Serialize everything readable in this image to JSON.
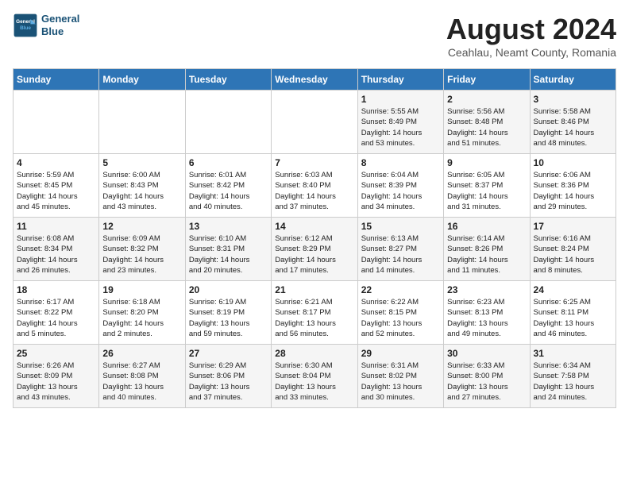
{
  "header": {
    "logo_line1": "General",
    "logo_line2": "Blue",
    "title": "August 2024",
    "subtitle": "Ceahlau, Neamt County, Romania"
  },
  "weekdays": [
    "Sunday",
    "Monday",
    "Tuesday",
    "Wednesday",
    "Thursday",
    "Friday",
    "Saturday"
  ],
  "weeks": [
    [
      {
        "day": "",
        "info": ""
      },
      {
        "day": "",
        "info": ""
      },
      {
        "day": "",
        "info": ""
      },
      {
        "day": "",
        "info": ""
      },
      {
        "day": "1",
        "info": "Sunrise: 5:55 AM\nSunset: 8:49 PM\nDaylight: 14 hours\nand 53 minutes."
      },
      {
        "day": "2",
        "info": "Sunrise: 5:56 AM\nSunset: 8:48 PM\nDaylight: 14 hours\nand 51 minutes."
      },
      {
        "day": "3",
        "info": "Sunrise: 5:58 AM\nSunset: 8:46 PM\nDaylight: 14 hours\nand 48 minutes."
      }
    ],
    [
      {
        "day": "4",
        "info": "Sunrise: 5:59 AM\nSunset: 8:45 PM\nDaylight: 14 hours\nand 45 minutes."
      },
      {
        "day": "5",
        "info": "Sunrise: 6:00 AM\nSunset: 8:43 PM\nDaylight: 14 hours\nand 43 minutes."
      },
      {
        "day": "6",
        "info": "Sunrise: 6:01 AM\nSunset: 8:42 PM\nDaylight: 14 hours\nand 40 minutes."
      },
      {
        "day": "7",
        "info": "Sunrise: 6:03 AM\nSunset: 8:40 PM\nDaylight: 14 hours\nand 37 minutes."
      },
      {
        "day": "8",
        "info": "Sunrise: 6:04 AM\nSunset: 8:39 PM\nDaylight: 14 hours\nand 34 minutes."
      },
      {
        "day": "9",
        "info": "Sunrise: 6:05 AM\nSunset: 8:37 PM\nDaylight: 14 hours\nand 31 minutes."
      },
      {
        "day": "10",
        "info": "Sunrise: 6:06 AM\nSunset: 8:36 PM\nDaylight: 14 hours\nand 29 minutes."
      }
    ],
    [
      {
        "day": "11",
        "info": "Sunrise: 6:08 AM\nSunset: 8:34 PM\nDaylight: 14 hours\nand 26 minutes."
      },
      {
        "day": "12",
        "info": "Sunrise: 6:09 AM\nSunset: 8:32 PM\nDaylight: 14 hours\nand 23 minutes."
      },
      {
        "day": "13",
        "info": "Sunrise: 6:10 AM\nSunset: 8:31 PM\nDaylight: 14 hours\nand 20 minutes."
      },
      {
        "day": "14",
        "info": "Sunrise: 6:12 AM\nSunset: 8:29 PM\nDaylight: 14 hours\nand 17 minutes."
      },
      {
        "day": "15",
        "info": "Sunrise: 6:13 AM\nSunset: 8:27 PM\nDaylight: 14 hours\nand 14 minutes."
      },
      {
        "day": "16",
        "info": "Sunrise: 6:14 AM\nSunset: 8:26 PM\nDaylight: 14 hours\nand 11 minutes."
      },
      {
        "day": "17",
        "info": "Sunrise: 6:16 AM\nSunset: 8:24 PM\nDaylight: 14 hours\nand 8 minutes."
      }
    ],
    [
      {
        "day": "18",
        "info": "Sunrise: 6:17 AM\nSunset: 8:22 PM\nDaylight: 14 hours\nand 5 minutes."
      },
      {
        "day": "19",
        "info": "Sunrise: 6:18 AM\nSunset: 8:20 PM\nDaylight: 14 hours\nand 2 minutes."
      },
      {
        "day": "20",
        "info": "Sunrise: 6:19 AM\nSunset: 8:19 PM\nDaylight: 13 hours\nand 59 minutes."
      },
      {
        "day": "21",
        "info": "Sunrise: 6:21 AM\nSunset: 8:17 PM\nDaylight: 13 hours\nand 56 minutes."
      },
      {
        "day": "22",
        "info": "Sunrise: 6:22 AM\nSunset: 8:15 PM\nDaylight: 13 hours\nand 52 minutes."
      },
      {
        "day": "23",
        "info": "Sunrise: 6:23 AM\nSunset: 8:13 PM\nDaylight: 13 hours\nand 49 minutes."
      },
      {
        "day": "24",
        "info": "Sunrise: 6:25 AM\nSunset: 8:11 PM\nDaylight: 13 hours\nand 46 minutes."
      }
    ],
    [
      {
        "day": "25",
        "info": "Sunrise: 6:26 AM\nSunset: 8:09 PM\nDaylight: 13 hours\nand 43 minutes."
      },
      {
        "day": "26",
        "info": "Sunrise: 6:27 AM\nSunset: 8:08 PM\nDaylight: 13 hours\nand 40 minutes."
      },
      {
        "day": "27",
        "info": "Sunrise: 6:29 AM\nSunset: 8:06 PM\nDaylight: 13 hours\nand 37 minutes."
      },
      {
        "day": "28",
        "info": "Sunrise: 6:30 AM\nSunset: 8:04 PM\nDaylight: 13 hours\nand 33 minutes."
      },
      {
        "day": "29",
        "info": "Sunrise: 6:31 AM\nSunset: 8:02 PM\nDaylight: 13 hours\nand 30 minutes."
      },
      {
        "day": "30",
        "info": "Sunrise: 6:33 AM\nSunset: 8:00 PM\nDaylight: 13 hours\nand 27 minutes."
      },
      {
        "day": "31",
        "info": "Sunrise: 6:34 AM\nSunset: 7:58 PM\nDaylight: 13 hours\nand 24 minutes."
      }
    ]
  ]
}
